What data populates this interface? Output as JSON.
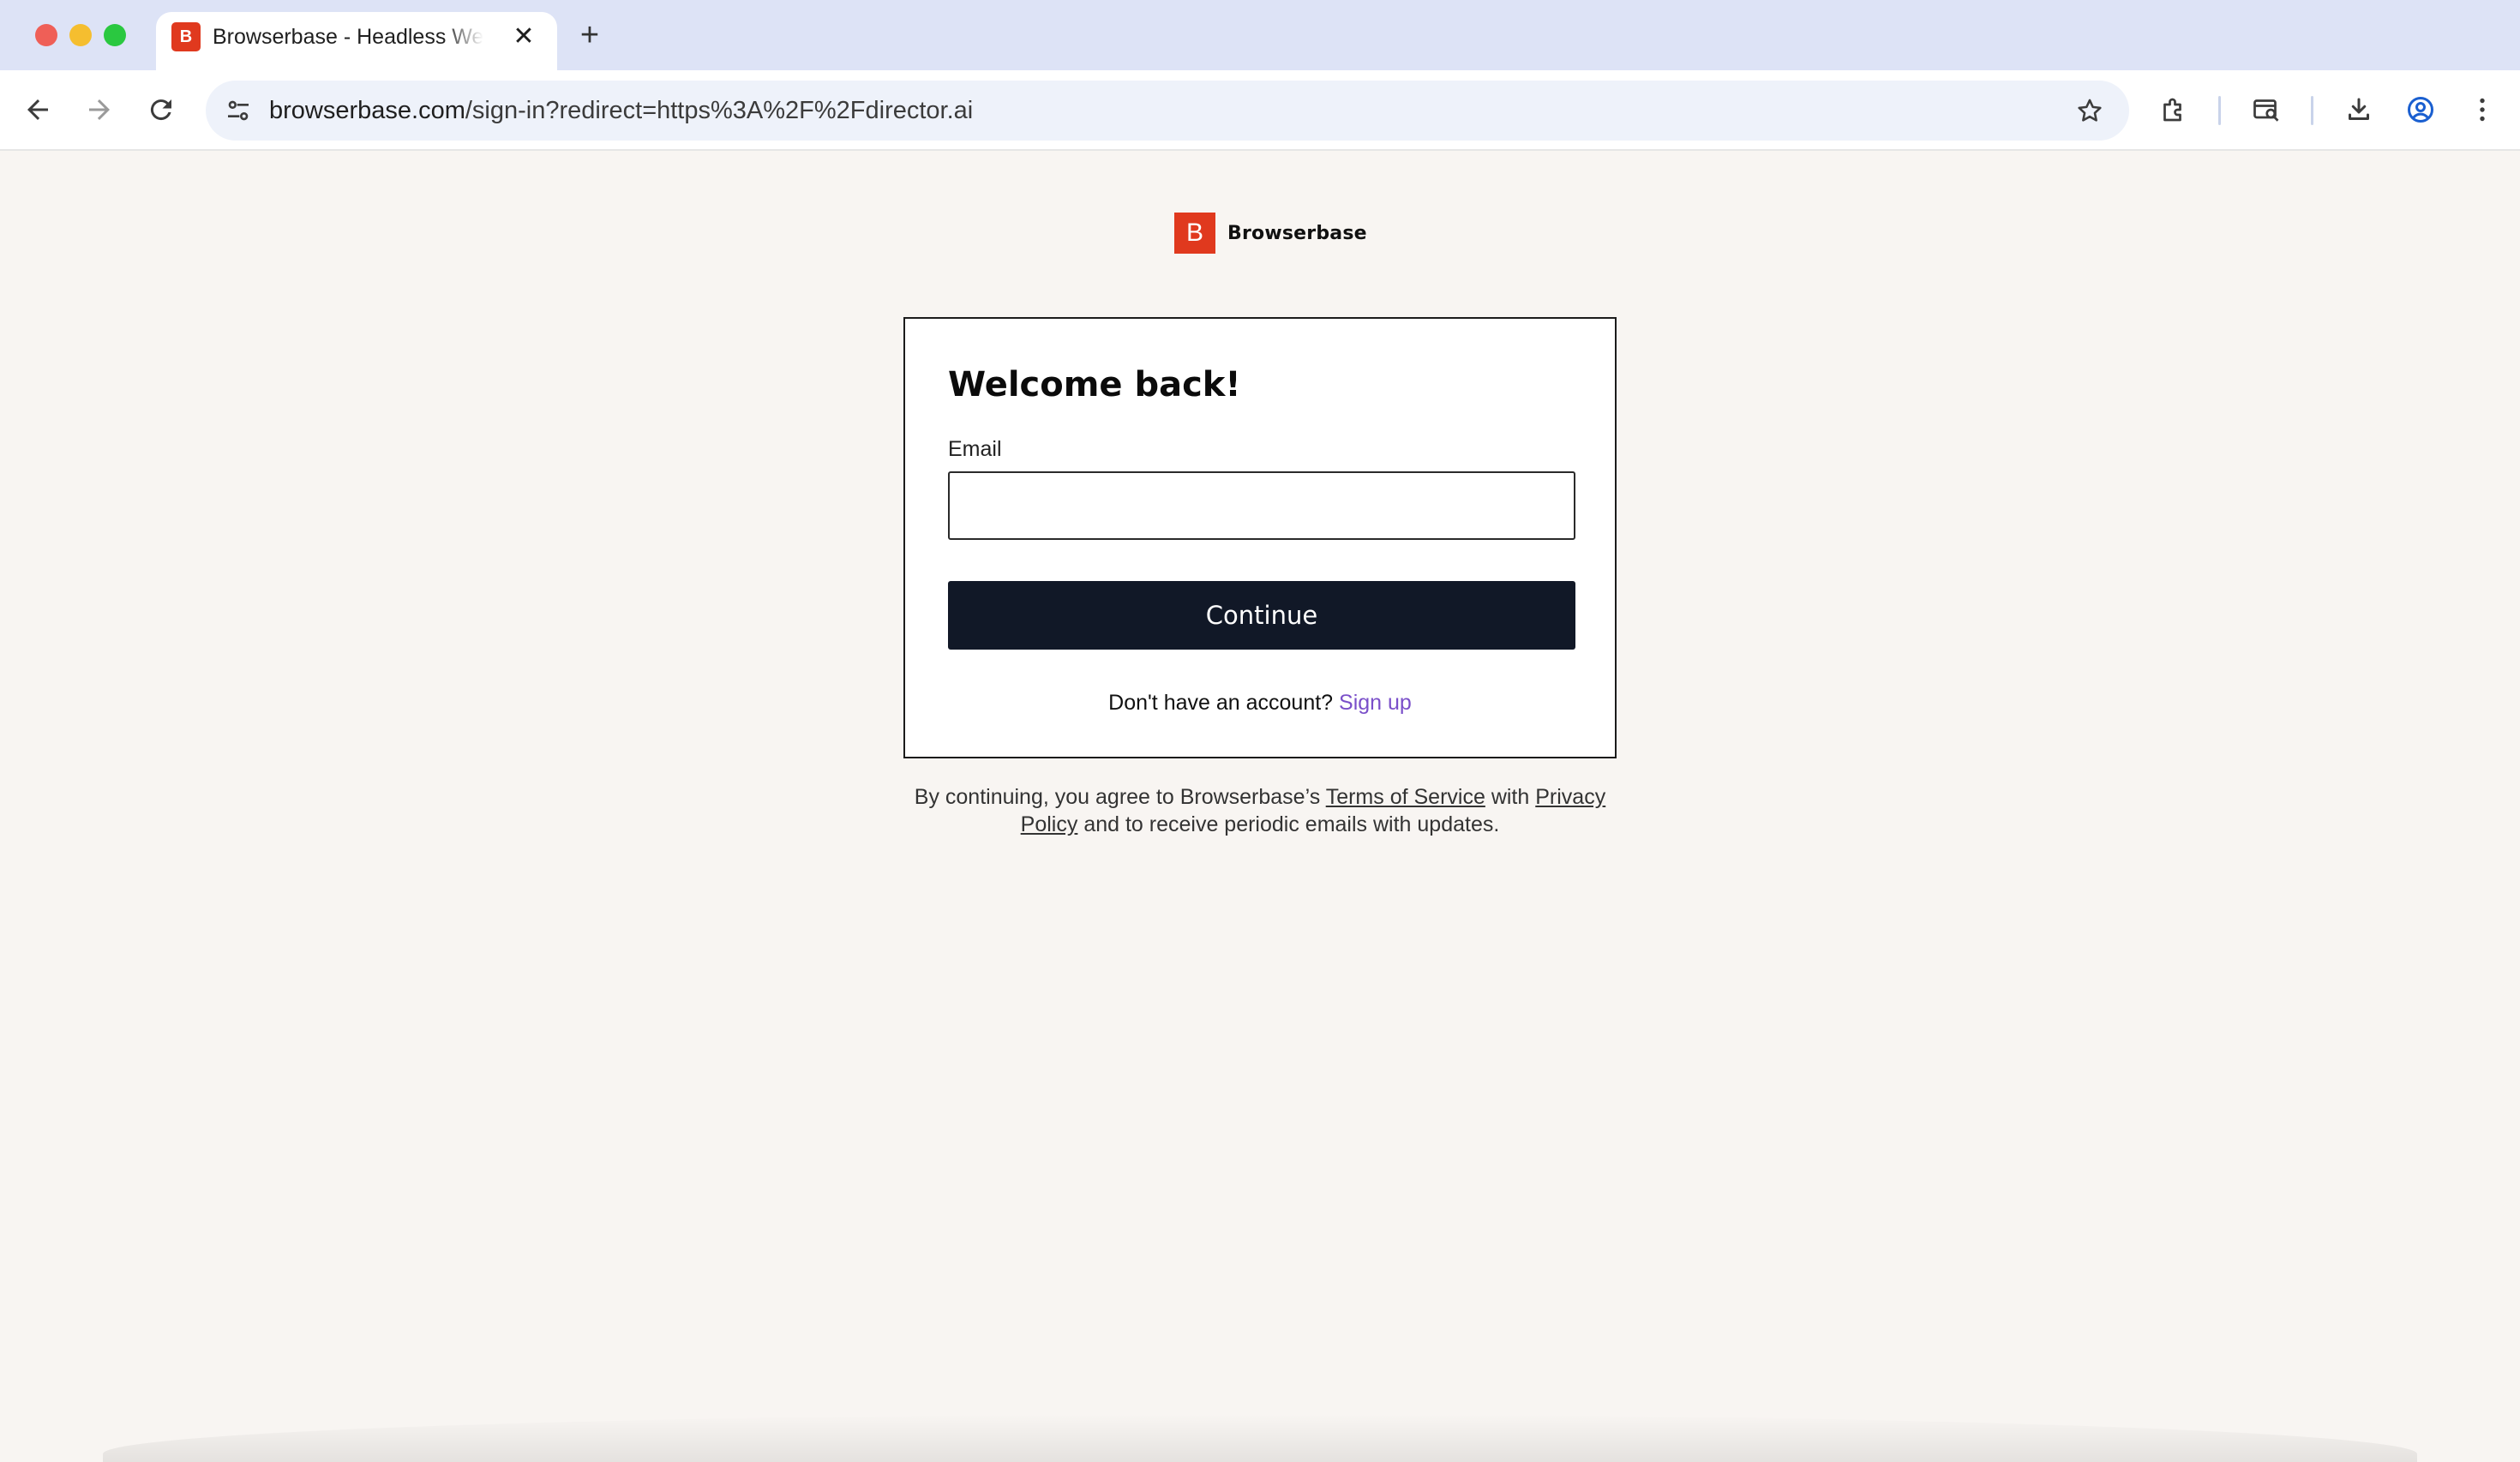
{
  "browser": {
    "tab": {
      "favicon_letter": "B",
      "title": "Browserbase - Headless Web Browsers for AI Agents",
      "close_glyph": "✕"
    },
    "new_tab_glyph": "+",
    "address_bar": {
      "url_domain": "browserbase.com",
      "url_path": "/sign-in?redirect=https%3A%2F%2Fdirector.ai"
    },
    "icons": {
      "back": "back-arrow-icon",
      "forward": "forward-arrow-icon",
      "reload": "reload-icon",
      "site_settings": "tune-icon",
      "bookmark": "star-icon",
      "extensions": "puzzle-icon",
      "tab_search": "tab-search-icon",
      "downloads": "download-icon",
      "profile": "profile-icon",
      "menu": "kebab-menu-icon"
    }
  },
  "page": {
    "brand": {
      "mark_letter": "B",
      "name": "Browserbase",
      "color": "#e0391e"
    },
    "card": {
      "title": "Welcome back!",
      "email_label": "Email",
      "email_value": "",
      "email_placeholder": "",
      "continue_label": "Continue",
      "signup_prompt": "Don't have an account?",
      "signup_link": "Sign up"
    },
    "legal": {
      "prefix": "By continuing, you agree to Browserbase’s",
      "terms_link": "Terms of Service",
      "middle": "with",
      "privacy_link": "Privacy Policy",
      "suffix": "and to receive periodic emails with updates."
    },
    "colors": {
      "background": "#f8f5f2",
      "button": "#111827",
      "link": "#7a4fc9"
    }
  }
}
